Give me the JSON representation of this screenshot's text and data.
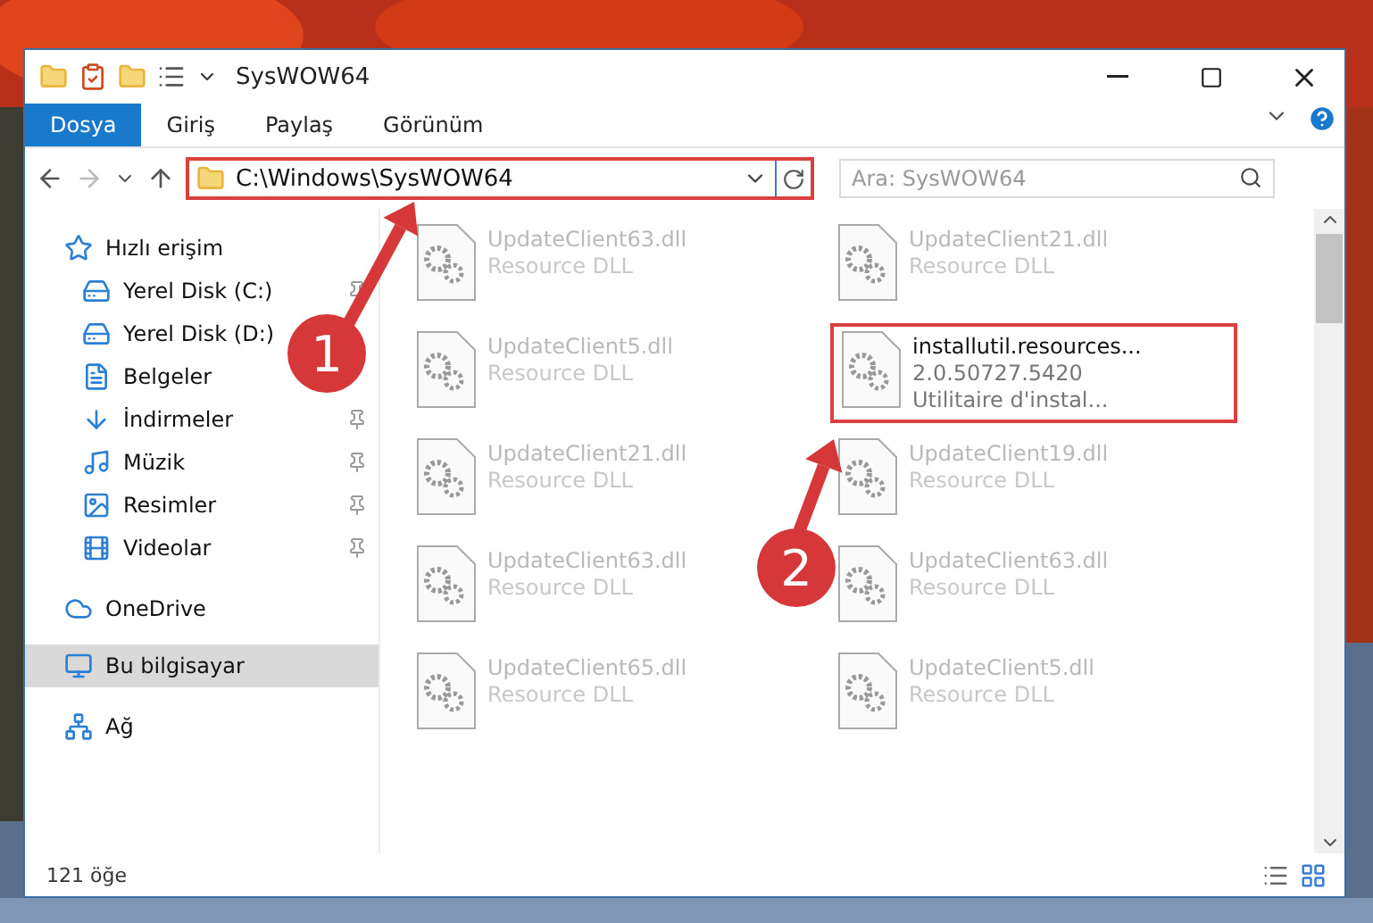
{
  "window": {
    "title": "SysWOW64"
  },
  "tabs": [
    {
      "label": "Dosya",
      "selected": true
    },
    {
      "label": "Giriş",
      "selected": false
    },
    {
      "label": "Paylaş",
      "selected": false
    },
    {
      "label": "Görünüm",
      "selected": false
    }
  ],
  "address": {
    "path": "C:\\Windows\\SysWOW64"
  },
  "search": {
    "placeholder": "Ara: SysWOW64"
  },
  "nav": [
    {
      "label": "Hızlı erişim",
      "selected": false,
      "children": [
        {
          "label": "Yerel Disk (C:)",
          "pinned": true
        },
        {
          "label": "Yerel Disk (D:)",
          "pinned": false
        },
        {
          "label": "Belgeler",
          "pinned": false
        },
        {
          "label": "İndirmeler",
          "pinned": true
        },
        {
          "label": "Müzik",
          "pinned": true
        },
        {
          "label": "Resimler",
          "pinned": true
        },
        {
          "label": "Videolar",
          "pinned": true
        }
      ]
    },
    {
      "label": "OneDrive",
      "selected": false
    },
    {
      "label": "Bu bilgisayar",
      "selected": true
    },
    {
      "label": "Ağ",
      "selected": false
    }
  ],
  "files": [
    {
      "name": "UpdateClient63.dll",
      "details": [
        "Resource DLL"
      ],
      "selected": false
    },
    {
      "name": "UpdateClient21.dll",
      "details": [
        "Resource DLL"
      ],
      "selected": false
    },
    {
      "name": "UpdateClient5.dll",
      "details": [
        "Resource DLL"
      ],
      "selected": false
    },
    {
      "name": "installutil.resources...",
      "details": [
        "2.0.50727.5420",
        "Utilitaire d'instal..."
      ],
      "selected": true
    },
    {
      "name": "UpdateClient21.dll",
      "details": [
        "Resource DLL"
      ],
      "selected": false
    },
    {
      "name": "UpdateClient19.dll",
      "details": [
        "Resource DLL"
      ],
      "selected": false
    },
    {
      "name": "UpdateClient63.dll",
      "details": [
        "Resource DLL"
      ],
      "selected": false
    },
    {
      "name": "UpdateClient63.dll",
      "details": [
        "Resource DLL"
      ],
      "selected": false
    },
    {
      "name": "UpdateClient65.dll",
      "details": [
        "Resource DLL"
      ],
      "selected": false
    },
    {
      "name": "UpdateClient5.dll",
      "details": [
        "Resource DLL"
      ],
      "selected": false
    }
  ],
  "callouts": [
    {
      "number": "1"
    },
    {
      "number": "2"
    }
  ],
  "status_bar": {
    "count": "121 öğe"
  }
}
